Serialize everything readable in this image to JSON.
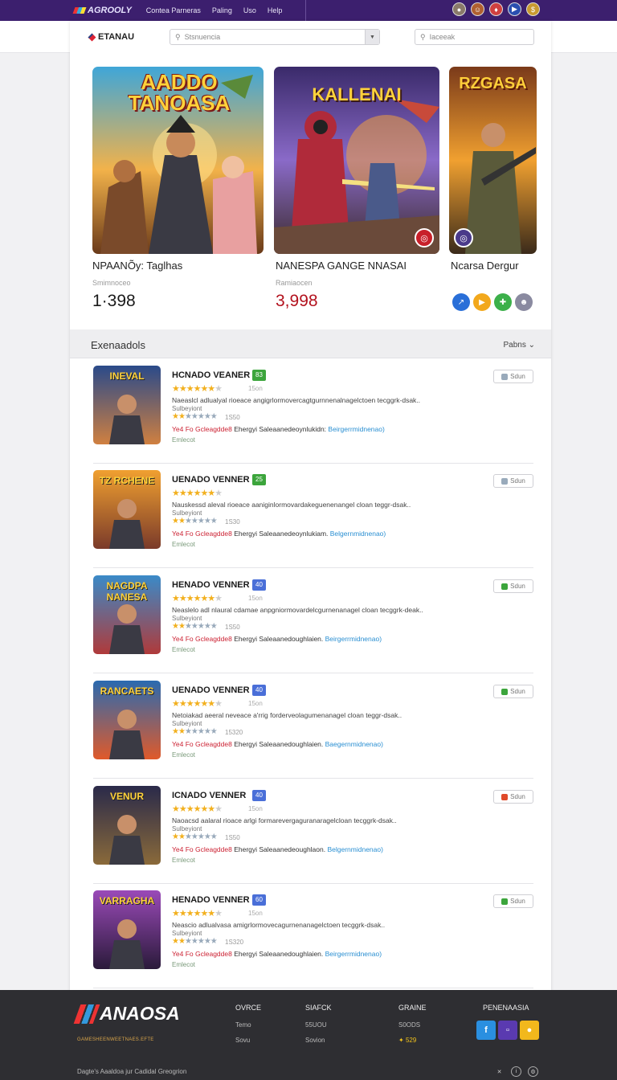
{
  "topnav": {
    "brand": "AGROOLY",
    "links": [
      "Contea Parneras",
      "Paling",
      "Uso",
      "Help"
    ]
  },
  "header": {
    "site_name": "ETANAU",
    "search_placeholder": "Stsnuencia",
    "side_search_placeholder": "Iaceeak"
  },
  "featured": [
    {
      "art_title": "AADDO TANOASA",
      "title": "NPAANÕy: Taglhas",
      "subtitle": "Smimnoceo",
      "price": "1·398"
    },
    {
      "art_title": "KALLENAI",
      "title": "NANESPA GANGE NNASAI",
      "subtitle": "Ramiaocen",
      "price": "3,998"
    },
    {
      "art_title": "RZGASA",
      "title": "Ncarsa Dergur",
      "subtitle": "",
      "price": ""
    }
  ],
  "section": {
    "title": "Exenaadols",
    "sort_label": "Pabns"
  },
  "list": [
    {
      "art": "INEVAL",
      "name": "HCNADO VEANER",
      "tag": "83",
      "tag_color": "#3ca53c",
      "rating_label": "15on",
      "desc": "Naeaslcl adlualyal rioeace angigrlormovercagtgurnnenalnagelctoen tecggrk-dsak..",
      "sub1": "Sulbeyiont",
      "rating2": "1S50",
      "meta_red": "Ye4 Fo Gcleagdde8",
      "meta_text": "Ehergyi Saleaanedeoynlukidn:",
      "meta_blue": "Beirgerrmidnenao)",
      "sub2": "Emlecot",
      "save": "Sdun",
      "save_color": "#9ab"
    },
    {
      "art": "TZ RCHENE",
      "name": "UENADO VENNER",
      "tag": "25",
      "tag_color": "#3ca53c",
      "rating_label": "",
      "desc": "Nauskessd aleval rioeace aaniginlormovardakeguenenangel cloan teggr-dsak..",
      "sub1": "Sulbeyiont",
      "rating2": "1S30",
      "meta_red": "Ye4 Fo Gcleagdde8",
      "meta_text": "Ehergyi Saleaanedeoynlukiam.",
      "meta_blue": "Belgernmidnenao)",
      "sub2": "Emlecot",
      "save": "Sdun",
      "save_color": "#9ab"
    },
    {
      "art": "NAGDPA NANESA",
      "name": "HENADO VENNER",
      "tag": "40",
      "tag_color": "#4a6fd8",
      "rating_label": "15on",
      "desc": "Neaslelo adl nlaural cdamae anpgniormovardelcgurnenanagel cloan tecggrk-deak..",
      "sub1": "Sulbeyiont",
      "rating2": "1S50",
      "meta_red": "Ye4 Fo Gcleagdde8",
      "meta_text": "Ehergyi Saleaanedoughlaien.",
      "meta_blue": "Beirgerrmidnenao)",
      "sub2": "Emlecot",
      "save": "Sdun",
      "save_color": "#3ca53c"
    },
    {
      "art": "RANCAETS",
      "name": "UENADO VENNER",
      "tag": "40",
      "tag_color": "#4a6fd8",
      "rating_label": "15on",
      "desc": "Netoiakad aeeral neveace a'rrig forderveolagumenanagel cloan teggr-dsak..",
      "sub1": "Sulbeyiont",
      "rating2": "15320",
      "meta_red": "Ye4 Fo Gcleagdde8",
      "meta_text": "Ehergyi Saleaanedoughlaien.",
      "meta_blue": "Baegernmidnenao)",
      "sub2": "Emlecot",
      "save": "Sdun",
      "save_color": "#3ca53c"
    },
    {
      "art": "VENUR",
      "name": "ICNADO VENNER",
      "tag": "40",
      "tag_color": "#4a6fd8",
      "rating_label": "15on",
      "desc": "Naoacsd aalaral rioace arlgi formarevergaguranaragelcloan tecggrk-dsak..",
      "sub1": "Sulbeyiont",
      "rating2": "1S50",
      "meta_red": "Ye4 Fo Gcleagdde8",
      "meta_text": "Ehergyi Saleaanedeoughlaon.",
      "meta_blue": "Belgernmidnenao)",
      "sub2": "Emlecot",
      "save": "Sdun",
      "save_color": "#e04a2a"
    },
    {
      "art": "VARRAGHA",
      "name": "HENADO VENNER",
      "tag": "60",
      "tag_color": "#4a6fd8",
      "rating_label": "15on",
      "desc": "Neascio adlualvasa amigrlormovecagurnenanagelctoen tecggrk-dsak..",
      "sub1": "Sulbeyiont",
      "rating2": "1S320",
      "meta_red": "Ye4 Fo Gcleagdde8",
      "meta_text": "Ehergyi Saleaanedoughlaien.",
      "meta_blue": "Beirgerrmidnenao)",
      "sub2": "Emlecot",
      "save": "Sdun",
      "save_color": "#3ca53c"
    }
  ],
  "footer": {
    "brand": "ANAOSA",
    "tagline": "GAMESHEENWEETNAES.EFTE",
    "col1": {
      "heading": "OVRCE",
      "links": [
        "Temo",
        "Sovu"
      ]
    },
    "col2": {
      "heading": "SIAFCK",
      "links": [
        "55UOU",
        "Sovion"
      ]
    },
    "col3": {
      "heading": "GRAINE",
      "links": [
        "S0ODS",
        "529"
      ]
    },
    "col4": {
      "heading": "PENENAASIA"
    },
    "bottom_text": "Dagte's Aaaldoa jur Cadidal Greogrion"
  }
}
